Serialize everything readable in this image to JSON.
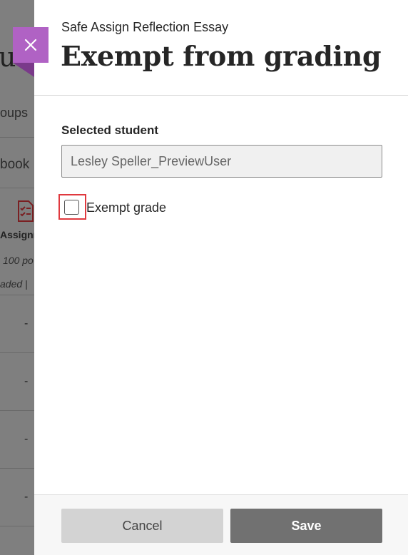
{
  "background": {
    "title_fragment": "u",
    "tab_fragment": "oups",
    "gradebook_fragment": "book",
    "column_label": "Assignı",
    "points_fragment": "100 po",
    "status_fragment": "aded |",
    "rows": [
      "-",
      "-",
      "-",
      "-"
    ]
  },
  "panel": {
    "subtitle": "Safe Assign Reflection Essay",
    "title": "Exempt from grading",
    "selected_student_label": "Selected student",
    "selected_student_value": "Lesley Speller_PreviewUser",
    "exempt_label": "Exempt grade",
    "exempt_checked": false
  },
  "footer": {
    "cancel_label": "Cancel",
    "save_label": "Save"
  },
  "colors": {
    "close_tab": "#b062c4",
    "highlight": "#e0393e",
    "save_button": "#717171",
    "cancel_button": "#d3d3d3"
  },
  "icons": {
    "close": "close-icon",
    "assignment": "assignment-icon"
  }
}
